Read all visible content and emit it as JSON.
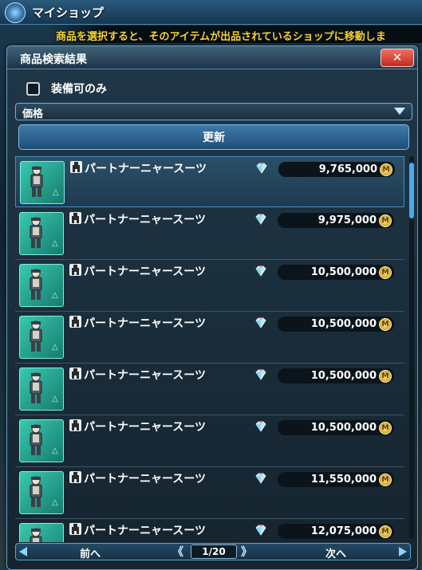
{
  "shop": {
    "title": "マイショップ",
    "emblem_icon": "shop-emblem-icon"
  },
  "hint": {
    "text": "商品を選択すると、そのアイテムが出品されているショップに移動しま"
  },
  "dialog": {
    "title": "商品検索結果",
    "close_icon": "close-icon",
    "equippable_only": {
      "label": "装備可のみ",
      "checked": false
    },
    "sort": {
      "selected": "価格"
    },
    "refresh_label": "更新"
  },
  "results": [
    {
      "name": "パートナーニャースーツ",
      "price": "9,765,000"
    },
    {
      "name": "パートナーニャースーツ",
      "price": "9,975,000"
    },
    {
      "name": "パートナーニャースーツ",
      "price": "10,500,000"
    },
    {
      "name": "パートナーニャースーツ",
      "price": "10,500,000"
    },
    {
      "name": "パートナーニャースーツ",
      "price": "10,500,000"
    },
    {
      "name": "パートナーニャースーツ",
      "price": "10,500,000"
    },
    {
      "name": "パートナーニャースーツ",
      "price": "11,550,000"
    },
    {
      "name": "パートナーニャースーツ",
      "price": "12,075,000"
    }
  ],
  "pager": {
    "prev_label": "前へ",
    "page": "1/20",
    "next_label": "次へ",
    "first_icon": "《",
    "last_icon": "》"
  },
  "colors": {
    "accent": "#4ca8e8",
    "hint_text": "#f3d23a",
    "close_button": "#d9402f",
    "thumb": "#2aa898"
  }
}
